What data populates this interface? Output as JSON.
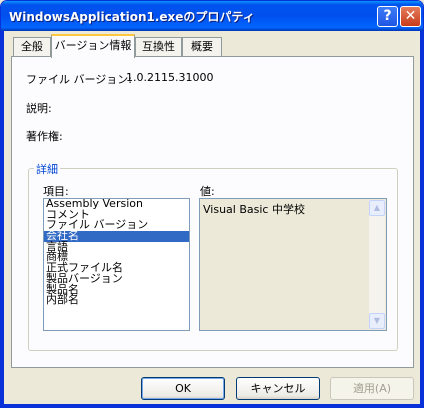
{
  "window": {
    "title": "WindowsApplication1.exeのプロパティ",
    "help_glyph": "?",
    "close_glyph": "✕"
  },
  "tabs": [
    {
      "label": "全般"
    },
    {
      "label": "バージョン情報"
    },
    {
      "label": "互換性"
    },
    {
      "label": "概要"
    }
  ],
  "version_panel": {
    "file_version_label": "ファイル バージョン:",
    "file_version_value": "1.0.2115.31000",
    "description_label": "説明:",
    "copyright_label": "著作権:",
    "detail_group_title": "詳細",
    "item_label": "項目:",
    "value_label": "値:",
    "items": [
      "Assembly Version",
      "コメント",
      "ファイル バージョン",
      "会社名",
      "言語",
      "商標",
      "正式ファイル名",
      "製品バージョン",
      "製品名",
      "内部名"
    ],
    "selected_item": "会社名",
    "value_text": "Visual Basic 中学校"
  },
  "buttons": {
    "ok": "OK",
    "cancel": "キャンセル",
    "apply": "適用(A)"
  },
  "colors": {
    "title_bar": "#0053ee",
    "selection": "#316ac5",
    "group_title": "#0046d5",
    "active_tab_accent": "#ffc83c"
  }
}
